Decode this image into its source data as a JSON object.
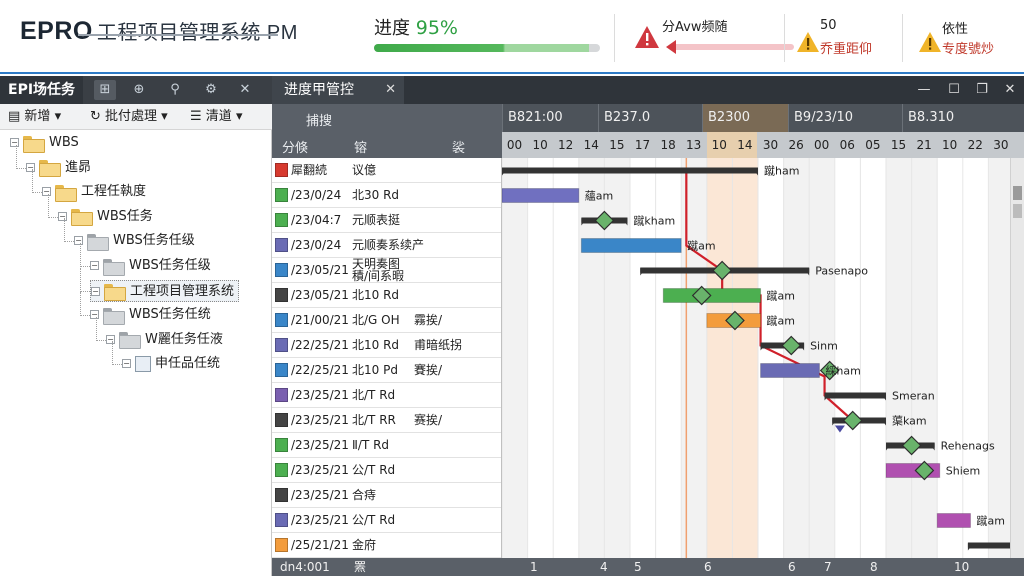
{
  "header": {
    "logo": "EPRO",
    "title": "工程项目管理系统 PM",
    "progress_label": "进度",
    "progress_value": "95%",
    "progress_fraction": 0.95,
    "alert_main": "分Avw频随",
    "alert2_count": "50",
    "alert2_text": "乔重距仰",
    "alert3_title": "依性",
    "alert3_text": "专度號炒",
    "colors": {
      "accent": "#2ea043",
      "danger": "#d0383f",
      "warning": "#f0b429"
    }
  },
  "left_panel": {
    "tab_title": "EPI场任务",
    "tab_icons": [
      "tree-icon",
      "zoom-icon",
      "link-icon",
      "group-icon",
      "close-icon"
    ],
    "tab_close": "✕",
    "toolbar": {
      "new_label": "新增",
      "process_label": "批付處理",
      "filter_label": "清道"
    },
    "tree": [
      {
        "label": "WBS",
        "level": 0,
        "icon": "folder"
      },
      {
        "label": "進昴",
        "level": 1,
        "icon": "folder"
      },
      {
        "label": "工程任執度",
        "level": 2,
        "icon": "folder"
      },
      {
        "label": "WBS任务",
        "level": 3,
        "icon": "folder"
      },
      {
        "label": "WBS任务任级",
        "level": 4,
        "icon": "folder-gray"
      },
      {
        "label": "WBS任务任级",
        "level": 5,
        "icon": "folder-gray"
      },
      {
        "label": "工程项目管理系统",
        "level": 5,
        "icon": "folder",
        "selected": true
      },
      {
        "label": "WBS任务任统",
        "level": 5,
        "icon": "folder-gray"
      },
      {
        "label": "W麗任务任液",
        "level": 6,
        "icon": "folder-gray"
      },
      {
        "label": "申任品任统",
        "level": 7,
        "icon": "doc"
      }
    ]
  },
  "gantt": {
    "tab_title": "进度甲管控",
    "tab_close": "✕",
    "window_controls": [
      "—",
      "☐",
      "❐",
      "✕"
    ],
    "col_header_1": "捕搜",
    "col_header_a": "分倏",
    "col_header_b": "镕",
    "col_header_c": "裟",
    "months": [
      "B821:00",
      "B237.0",
      "B2300",
      "B9/23/10",
      "B8.310"
    ],
    "days": [
      "00",
      "10",
      "12",
      "14",
      "15",
      "17",
      "18",
      "13",
      "10",
      "14",
      "30",
      "26",
      "00",
      "06",
      "05",
      "15",
      "21",
      "10",
      "22",
      "30"
    ],
    "rows": [
      {
        "color": "#d73a2f",
        "c1": "犀翻続",
        "c2": "议億",
        "c3": ""
      },
      {
        "color": "#4caf50",
        "c1": "/23/0/24",
        "c2": "北30 Rd",
        "c3": ""
      },
      {
        "color": "#4caf50",
        "c1": "/23/04:7",
        "c2": "元顺表挺",
        "c3": ""
      },
      {
        "color": "#6a6bb4",
        "c1": "/23/0/24",
        "c2": "元顺奏系续产",
        "c3": ""
      },
      {
        "color": "#3a86c8",
        "c1": "/23/05/21",
        "c2": "天明奏图",
        "c2b": "積/间系暇",
        "c3": ""
      },
      {
        "color": "#444",
        "c1": "/23/05/21",
        "c2": "北10 Rd",
        "c3": ""
      },
      {
        "color": "#3a86c8",
        "c1": "/21/00/21",
        "c2": "北/G OH",
        "c3": "霧挨/"
      },
      {
        "color": "#6a6bb4",
        "c1": "/22/25/21",
        "c2": "北10 Rd",
        "c3": "甫暗纸拐"
      },
      {
        "color": "#3a86c8",
        "c1": "/22/25/21",
        "c2": "北10 Pd",
        "c3": "賽挨/"
      },
      {
        "color": "#7a5fb0",
        "c1": "/23/25/21",
        "c2": "北/T Rd",
        "c3": ""
      },
      {
        "color": "#444",
        "c1": "/23/25/21",
        "c2": "北/T RR",
        "c3": "赛挨/"
      },
      {
        "color": "#4caf50",
        "c1": "/23/25/21",
        "c2": "Ⅱ/T Rd",
        "c3": ""
      },
      {
        "color": "#4caf50",
        "c1": "/23/25/21",
        "c2": "公/T Rd",
        "c3": ""
      },
      {
        "color": "#444",
        "c1": "/23/25/21",
        "c2": "合痔",
        "c3": ""
      },
      {
        "color": "#6a6bb4",
        "c1": "/23/25/21",
        "c2": "公/T Rd",
        "c3": ""
      },
      {
        "color": "#f39c3c",
        "c1": "/25/21/21",
        "c2": "金府",
        "c3": ""
      }
    ],
    "bars": [
      {
        "type": "summary",
        "start": 0.0,
        "end": 10.0,
        "row": 0,
        "label": "蹴ham"
      },
      {
        "type": "task",
        "start": 0.0,
        "end": 3.0,
        "row": 1,
        "color": "#7070c0",
        "label": "蘊am"
      },
      {
        "type": "summary",
        "start": 3.1,
        "end": 4.9,
        "row": 2,
        "milestone": 4.0,
        "label": "蹴kham"
      },
      {
        "type": "task",
        "start": 3.1,
        "end": 7.0,
        "row": 3,
        "color": "#3a86c8",
        "label": "蹴am"
      },
      {
        "type": "summary",
        "start": 5.4,
        "end": 12.0,
        "row": 4,
        "milestone": 8.6,
        "label": "Pasenapo"
      },
      {
        "type": "task",
        "start": 6.3,
        "end": 10.1,
        "row": 5,
        "color": "#4caf50",
        "milestone": 7.8,
        "label": "蹴am"
      },
      {
        "type": "task",
        "start": 8.0,
        "end": 10.1,
        "row": 6,
        "color": "#f39c3c",
        "milestone": 9.1,
        "label": "蹴am"
      },
      {
        "type": "summary",
        "start": 10.1,
        "end": 11.8,
        "row": 7,
        "milestone": 11.3,
        "label": "Sinm"
      },
      {
        "type": "task",
        "start": 10.1,
        "end": 12.4,
        "row": 8,
        "color": "#6a6bb4",
        "milestone": 12.8,
        "label": "綵ham"
      },
      {
        "type": "summary",
        "start": 12.6,
        "end": 15.0,
        "row": 9,
        "label": "Smeran"
      },
      {
        "type": "summary",
        "start": 12.9,
        "end": 15.0,
        "row": 10,
        "milestone": 13.7,
        "label": "蕖kam"
      },
      {
        "type": "summary",
        "start": 15.0,
        "end": 16.9,
        "row": 11,
        "milestone": 16.0,
        "label": "Rehenags"
      },
      {
        "type": "task",
        "start": 15.0,
        "end": 17.1,
        "row": 12,
        "color": "#b050b0",
        "milestone": 16.5,
        "label": "Shiem"
      },
      {
        "type": "task",
        "start": 17.0,
        "end": 18.3,
        "row": 14,
        "color": "#b050b0",
        "label": "蹴am"
      },
      {
        "type": "summary",
        "start": 18.2,
        "end": 20.0,
        "row": 15,
        "label": ""
      }
    ],
    "footer_left": "dn4:001",
    "footer_mid": "罴",
    "footer_ticks": [
      "1",
      "4",
      "5",
      "6",
      "6",
      "7",
      "8",
      "10"
    ]
  }
}
